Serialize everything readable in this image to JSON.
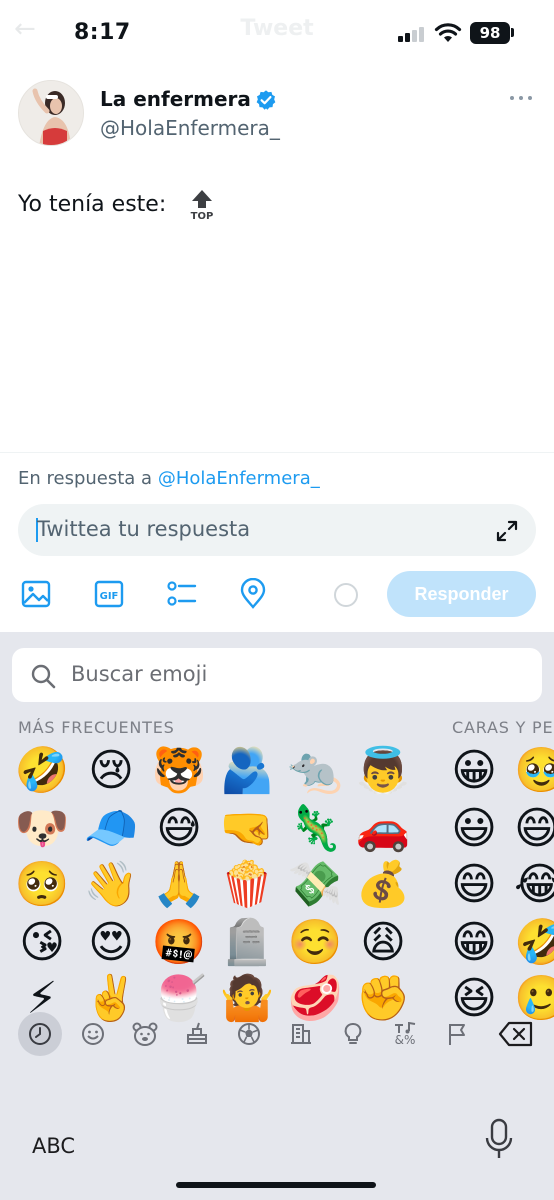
{
  "status_bar": {
    "time": "8:17",
    "battery": "98",
    "title_ghost": "Tweet"
  },
  "tweet": {
    "author_name": "La enfermera",
    "author_handle": "@HolaEnfermera_",
    "text": "Yo tenía este:",
    "emoji_label": "TOP"
  },
  "reply": {
    "in_reply_prefix": "En respuesta a",
    "in_reply_mention": "@HolaEnfermera_",
    "placeholder": "Twittea tu respuesta",
    "button_label": "Responder",
    "gif_label": "GIF"
  },
  "keyboard": {
    "search_placeholder": "Buscar emoji",
    "section_frequent": "MÁS FRECUENTES",
    "section_faces": "CARAS Y PE",
    "abc_label": "ABC",
    "category_symbols_label": "&%",
    "frequent_emojis": [
      "🤣",
      "😢",
      "🐯",
      "🫂",
      "🐀",
      "👼",
      "🐶",
      "🧢",
      "😅",
      "🤜",
      "🦎",
      "🚗",
      "🥺",
      "👋",
      "🙏",
      "🍿",
      "💸",
      "💰",
      "😘",
      "😍",
      "🤬",
      "🪦",
      "☺️",
      "😩",
      "⚡",
      "✌️",
      "🍧",
      "🤷",
      "🥩",
      "✊"
    ],
    "faces_emojis": [
      "😀",
      "🥹",
      "😃",
      "😄",
      "😄",
      "😂",
      "😁",
      "🤣",
      "😆",
      "🥲"
    ]
  },
  "colors": {
    "accent": "#1d9bf0",
    "verified": "#1d9bf0",
    "keyboard_bg": "#e5e7ed"
  }
}
